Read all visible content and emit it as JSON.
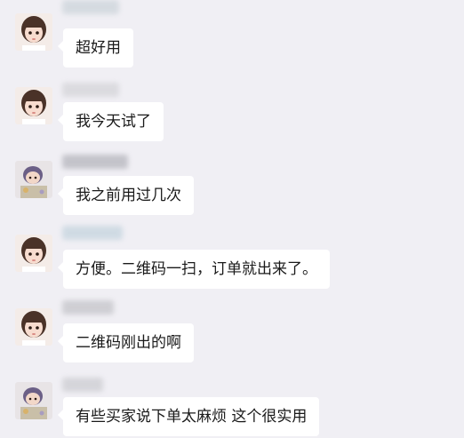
{
  "chat": {
    "messages": [
      {
        "text": "超好用"
      },
      {
        "text": "我今天试了"
      },
      {
        "text": "我之前用过几次"
      },
      {
        "text": "方便。二维码一扫，订单就出来了。"
      },
      {
        "text": "二维码刚出的啊"
      },
      {
        "text": "有些买家说下单太麻烦 这个很实用"
      }
    ]
  },
  "colors": {
    "background": "#f0eff4",
    "bubble": "#ffffff",
    "text": "#1a1a1a"
  }
}
